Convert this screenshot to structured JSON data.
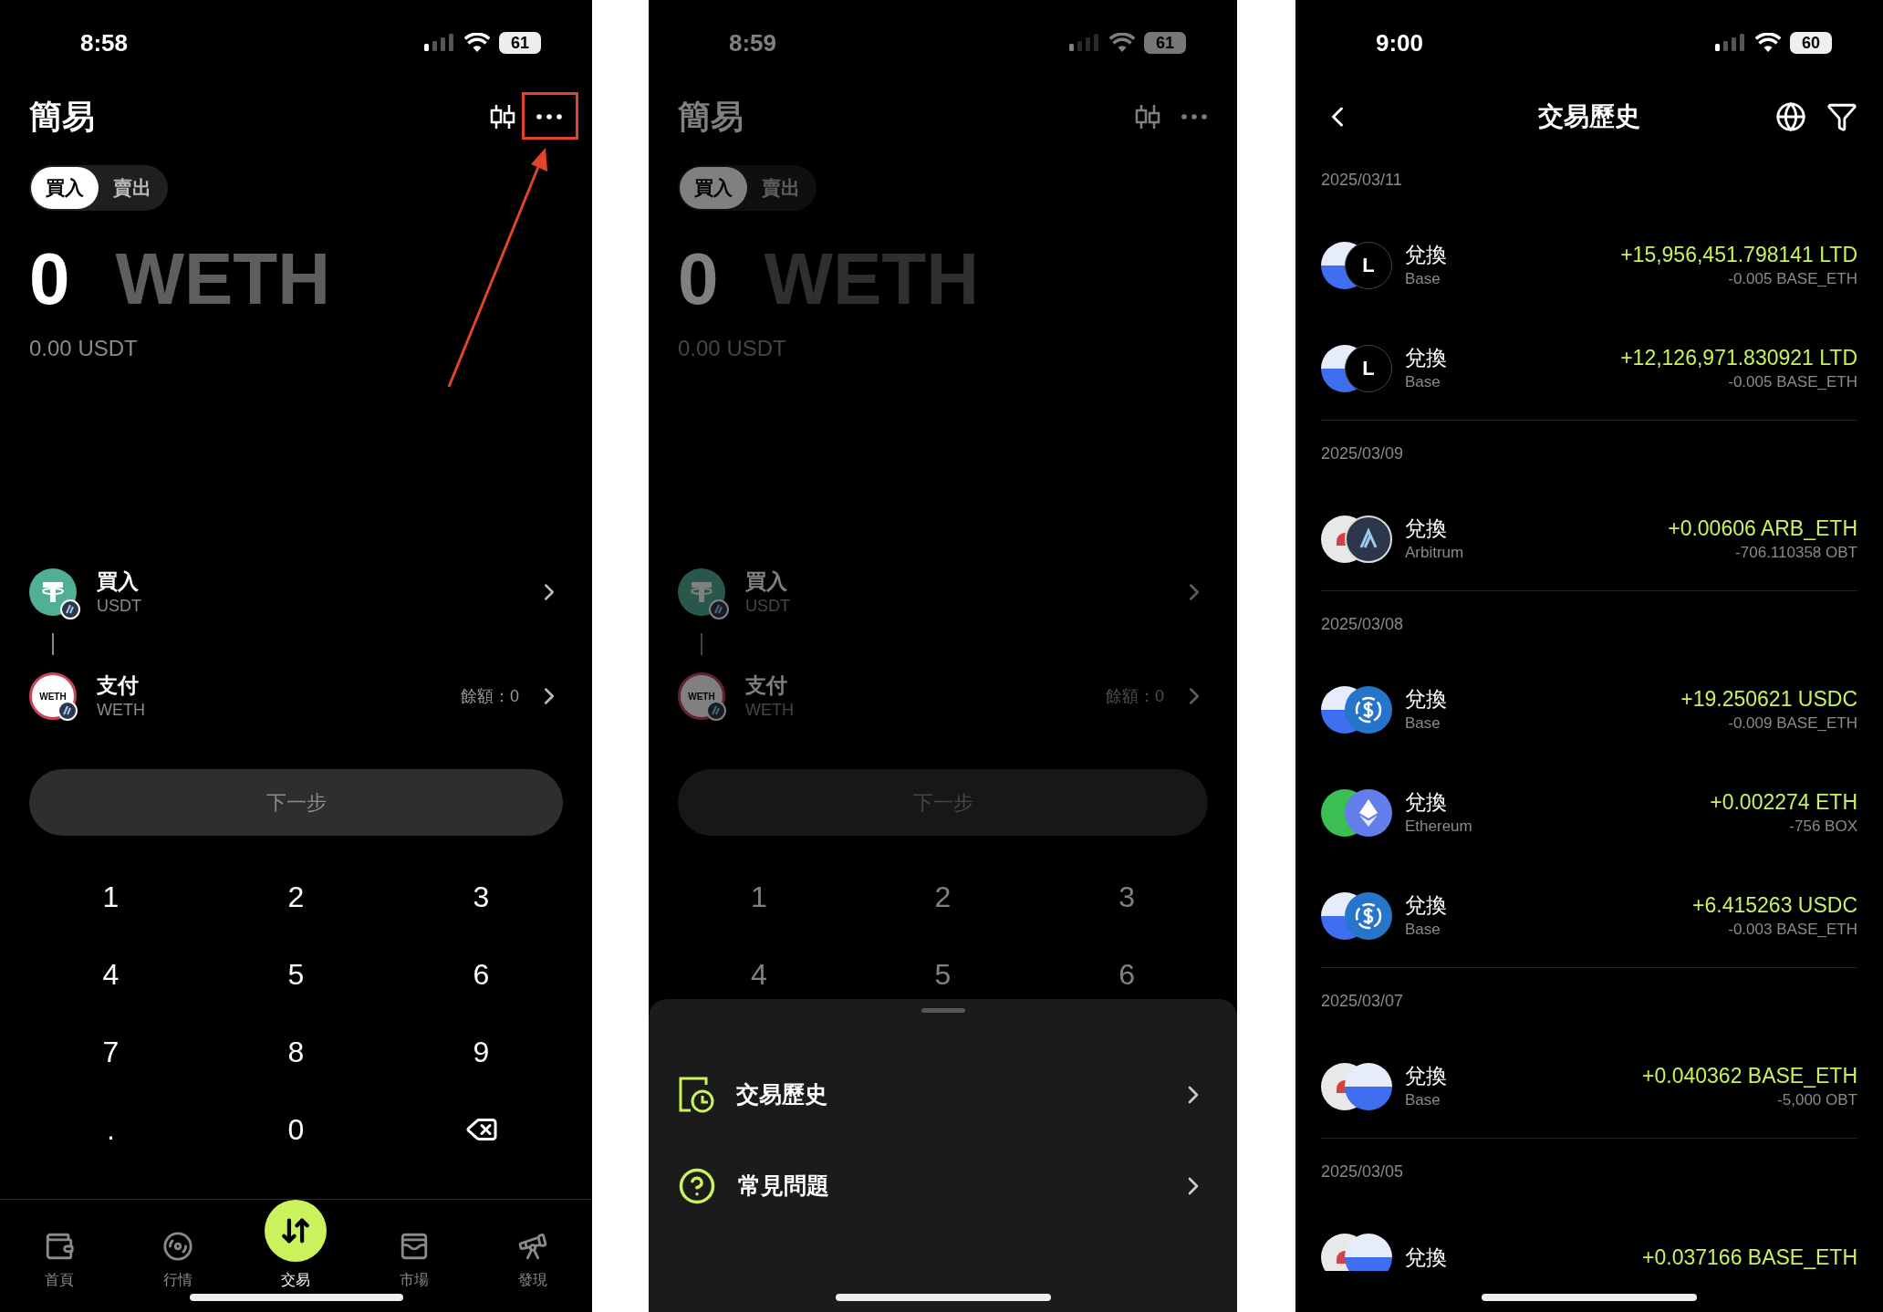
{
  "screens": [
    {
      "kind": "trade",
      "highlight_more": true,
      "status": {
        "time": "8:58",
        "battery": "61"
      },
      "title": "簡易",
      "mode_tabs": [
        {
          "label": "買入",
          "selected": true
        },
        {
          "label": "賣出",
          "selected": false
        }
      ],
      "amount": "0",
      "unit": "WETH",
      "fiat": "0.00 USDT",
      "legs": [
        {
          "kind": "usdt",
          "action": "買入",
          "token": "USDT"
        },
        {
          "kind": "weth",
          "logo_text": "WETH",
          "action": "支付",
          "token": "WETH",
          "balance": "餘額：0"
        }
      ],
      "next_button": "下一步",
      "keys": [
        "1",
        "2",
        "3",
        "4",
        "5",
        "6",
        "7",
        "8",
        "9",
        ".",
        "0"
      ],
      "backspace": true,
      "tabbar": [
        {
          "kind": "wallet",
          "label": "首頁",
          "selected": false
        },
        {
          "kind": "coins",
          "label": "行情",
          "selected": false
        },
        {
          "kind": "swap",
          "label": "交易",
          "selected": true
        },
        {
          "kind": "cards",
          "label": "市場",
          "selected": false
        },
        {
          "kind": "telescope",
          "label": "發現",
          "selected": false
        }
      ]
    },
    {
      "kind": "trade",
      "dimmed": true,
      "status": {
        "time": "8:59",
        "battery": "61"
      },
      "title": "簡易",
      "mode_tabs": [
        {
          "label": "買入",
          "selected": true
        },
        {
          "label": "賣出",
          "selected": false
        }
      ],
      "amount": "0",
      "unit": "WETH",
      "fiat": "0.00 USDT",
      "legs": [
        {
          "kind": "usdt",
          "action": "買入",
          "token": "USDT"
        },
        {
          "kind": "weth",
          "logo_text": "WETH",
          "action": "支付",
          "token": "WETH",
          "balance": "餘額：0"
        }
      ],
      "next_button": "下一步",
      "keys": [
        "1",
        "2",
        "3",
        "4",
        "5",
        "6"
      ],
      "sheet": {
        "items": [
          {
            "kind": "history",
            "label": "交易歷史"
          },
          {
            "kind": "faq",
            "label": "常見問題"
          }
        ]
      }
    },
    {
      "kind": "history",
      "status": {
        "time": "9:00",
        "battery": "60"
      },
      "title": "交易歷史",
      "groups": [
        {
          "date": "2025/03/11",
          "transactions": [
            {
              "kind": "base_letter",
              "letter": "L",
              "type": "兌換",
              "network": "Base",
              "amount": "+15,956,451.798141 LTD",
              "cost": "-0.005 BASE_ETH"
            },
            {
              "kind": "base_letter",
              "letter": "L",
              "type": "兌換",
              "network": "Base",
              "amount": "+12,126,971.830921 LTD",
              "cost": "-0.005 BASE_ETH"
            }
          ]
        },
        {
          "date": "2025/03/09",
          "transactions": [
            {
              "kind": "ufo_arb",
              "type": "兌換",
              "network": "Arbitrum",
              "amount": "+0.00606 ARB_ETH",
              "cost": "-706.110358 OBT"
            }
          ]
        },
        {
          "date": "2025/03/08",
          "transactions": [
            {
              "kind": "base_usdc",
              "type": "兌換",
              "network": "Base",
              "amount": "+19.250621 USDC",
              "cost": "-0.009 BASE_ETH"
            },
            {
              "kind": "chat_eth",
              "type": "兌換",
              "network": "Ethereum",
              "amount": "+0.002274 ETH",
              "cost": "-756 BOX"
            },
            {
              "kind": "base_usdc",
              "type": "兌換",
              "network": "Base",
              "amount": "+6.415263 USDC",
              "cost": "-0.003 BASE_ETH"
            }
          ]
        },
        {
          "date": "2025/03/07",
          "transactions": [
            {
              "kind": "ufo_base",
              "type": "兌換",
              "network": "Base",
              "amount": "+0.040362 BASE_ETH",
              "cost": "-5,000 OBT"
            }
          ]
        },
        {
          "date": "2025/03/05",
          "transactions": [
            {
              "kind": "ufo_base",
              "type": "兌換",
              "amount": "+0.037166 BASE_ETH"
            }
          ]
        }
      ]
    }
  ]
}
